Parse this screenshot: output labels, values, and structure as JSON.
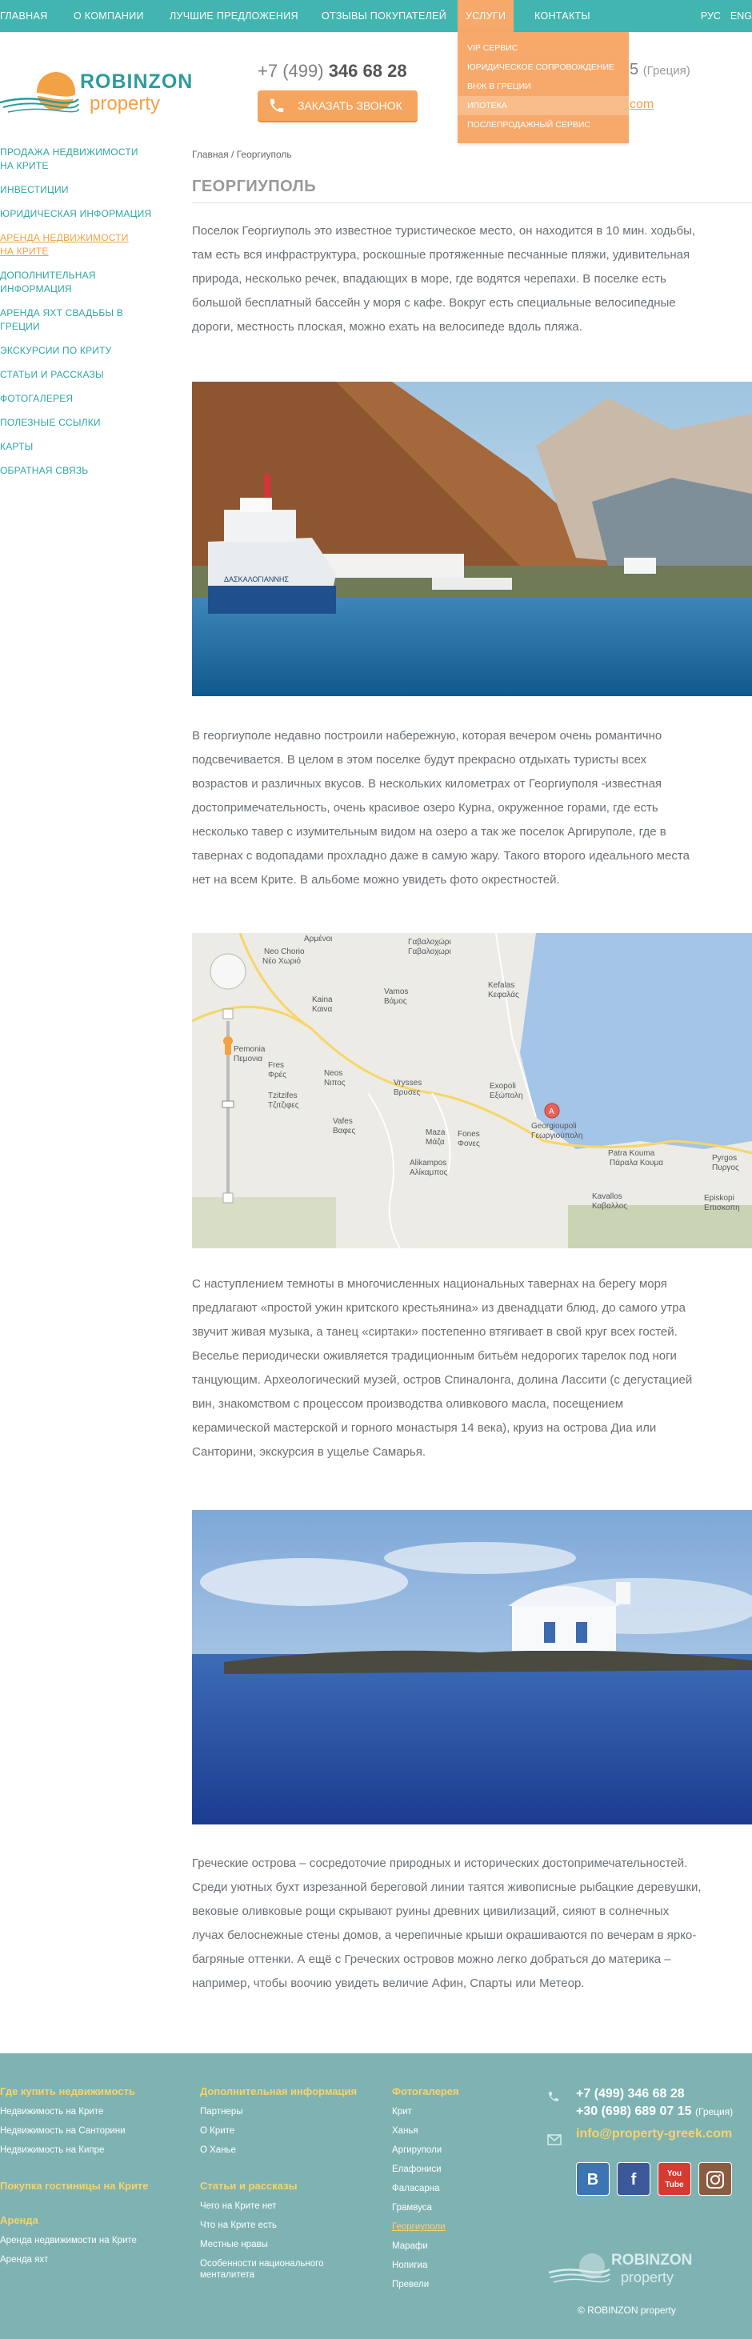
{
  "nav": {
    "items": [
      "Главная",
      "О компании",
      "Лучшие предложения",
      "Отзывы покупателей",
      "Услуги",
      "Контакты"
    ],
    "languages": [
      "РУС",
      "ENG"
    ]
  },
  "dropdown": {
    "items": [
      "VIP Сервис",
      "Юридическое сопровождение",
      "ВНЖ в Греции",
      "Ипотека",
      "Послепродажный сервис"
    ]
  },
  "header": {
    "logo_line1": "ROBINZON",
    "logo_line2": "property",
    "phone_prefix": "+7 (499)",
    "phone_number": "346 68 28",
    "call_button": "Заказать звонок",
    "phone2_number": "5",
    "phone2_country": "(Греция)",
    "email_fragment": "com"
  },
  "sidebar": {
    "items": [
      "Продажа недвижимости на Крите",
      "Инвестиции",
      "Юридическая информация",
      "Аренда недвижимости на Крите",
      "Дополнительная информация",
      "Аренда яхт свадьбы в Греции",
      "Экскурсии по Криту",
      "Статьи и рассказы",
      "Фотогалерея",
      "Полезные ссылки",
      "Карты",
      "Обратная связь"
    ]
  },
  "main": {
    "breadcrumb_home": "Главная",
    "breadcrumb_sep": " / ",
    "breadcrumb_current": "Георгиуполь",
    "title": "ГЕОРГИУПОЛЬ",
    "para1": "Поселок Георгиуполь это известное туристическое место, он находится в 10 мин. ходьбы, там есть вся инфраструктура, роскошные протяженные песчанные пляжи, удивительная природа, несколько речек, впадающих в море, где водятся черепахи. В поселке есть большой бесплатный бассейн у моря с кафе. Вокруг есть специальные велосипедные дороги, местность плоская, можно ехать на велосипеде вдоль пляжа.",
    "para2": "В георгиуполе недавно построили набережную, которая вечером очень романтично подсвечивается. В целом в этом поселке будут прекрасно отдыхать туристы всех возрастов и различных вкусов. В нескольких километрах от Георгиуполя -известная достопримечательность, очень красивое озеро Курна, окруженное горами, где есть несколько тавер с изумительным видом на озеро а так же поселок Аргируполе, где в тавернах с водопадами прохладно даже в самую жару. Такого второго идеального места нет на всем Крите. В альбоме можно увидеть фото окрестностей.",
    "para3": "С наступлением темноты в многочисленных национальных тавернах на берегу моря предлагают «простой ужин критского крестьянина» из двенадцати блюд, до самого утра звучит живая музыка, а танец «сиртаки» постепенно втягивает в свой круг всех гостей. Веселье периодически оживляется традиционным битьём недорогих тарелок под ноги танцующим. Археологический музей, остров Спиналонга, долина Лассити (с дегустацией вин, знакомством с процессом производства оливкового масла, посещением керамической мастерской и горного монастыря 14 века), круиз на острова Диа или Санторини, экскурсия в ущелье Самарья.",
    "para4": "Греческие острова – сосредоточие природных и исторических достопримечательностей. Среди уютных бухт изрезанной береговой линии таятся живописные рыбацкие деревушки, вековые оливковые рощи скрывают руины древних цивилизаций, сияют в солнечных лучах белоснежные стены домов, а черепичные крыши окрашиваются по вечерам в ярко-багряные оттенки. А ещё с Греческих островов можно легко добраться до материка – например, чтобы воочию увидеть величие Афин, Спарты или Метеор.",
    "ship_name": "ΔΑΣΚΑΛΟΓΙΑΝΝΗΣ"
  },
  "map": {
    "labels": [
      "Αρμένοι",
      "Neo Chorio",
      "Νέο Χωριό",
      "Γαβαλοχώρι",
      "Γαβαλοχωρι",
      "Vamos",
      "Βάμος",
      "Kefalas",
      "Κεφαλάς",
      "Kaina",
      "Καινα",
      "Pemonia",
      "Πεμονια",
      "Fres",
      "Φρές",
      "Tzitzifes",
      "Τζιτζιφες",
      "Neos",
      "Νιπος",
      "Vrysses",
      "Βρυσες",
      "Exopoli",
      "Εξώπολη",
      "Vafes",
      "Βαφες",
      "Maza",
      "Μάζα",
      "Fones",
      "Φονες",
      "Georgioupoli",
      "Γεωργιούπολη",
      "Alikampos",
      "Αλίκαμπος",
      "Patra Kouma",
      "Πάραλα Κουμα",
      "Pyrgos",
      "Πυργος",
      "Kavallos",
      "Καβαλλος",
      "Episkopi",
      "Επισκοπη"
    ],
    "marker": "A"
  },
  "footer": {
    "col1": {
      "head": "Где купить недвижимость",
      "items": [
        "Недвижимость на Крите",
        "Недвижимость на Санторини",
        "Недвижимость на Кипре"
      ],
      "head2": "Покупка гостиницы на Крите",
      "head3": "Аренда",
      "items3": [
        "Аренда недвижимости на Крите",
        "Аренда яхт"
      ]
    },
    "col2": {
      "head": "Дополнительная информация",
      "items": [
        "Партнеры",
        "О Крите",
        "О Ханье"
      ],
      "head2": "Статьи и рассказы",
      "items2": [
        "Чего на Крите нет",
        "Что на Крите есть",
        "Местные нравы",
        "Особенности национального менталитета"
      ]
    },
    "col3": {
      "head": "Фотогалерея",
      "items": [
        "Крит",
        "Ханья",
        "Аргируполи",
        "Елафониси",
        "Фаласарна",
        "Грамвуса",
        "Георгиуполи",
        "Марафи",
        "Нопигиа",
        "Превели"
      ]
    },
    "contacts": {
      "phone1": "+7 (499) 346 68 28",
      "phone2": "+30 (698) 689 07 15",
      "phone2_country": "(Греция)",
      "email": "info@property-greek.com"
    },
    "social": [
      "В",
      "f",
      "You Tube",
      ""
    ],
    "logo_line1": "ROBINZON",
    "logo_line2": "property",
    "copyright": "© ROBINZON property"
  },
  "colors": {
    "teal": "#43b5b0",
    "orange": "#f6a96b",
    "footer_bg": "#7fb3b3",
    "link": "#2fa7a0"
  }
}
